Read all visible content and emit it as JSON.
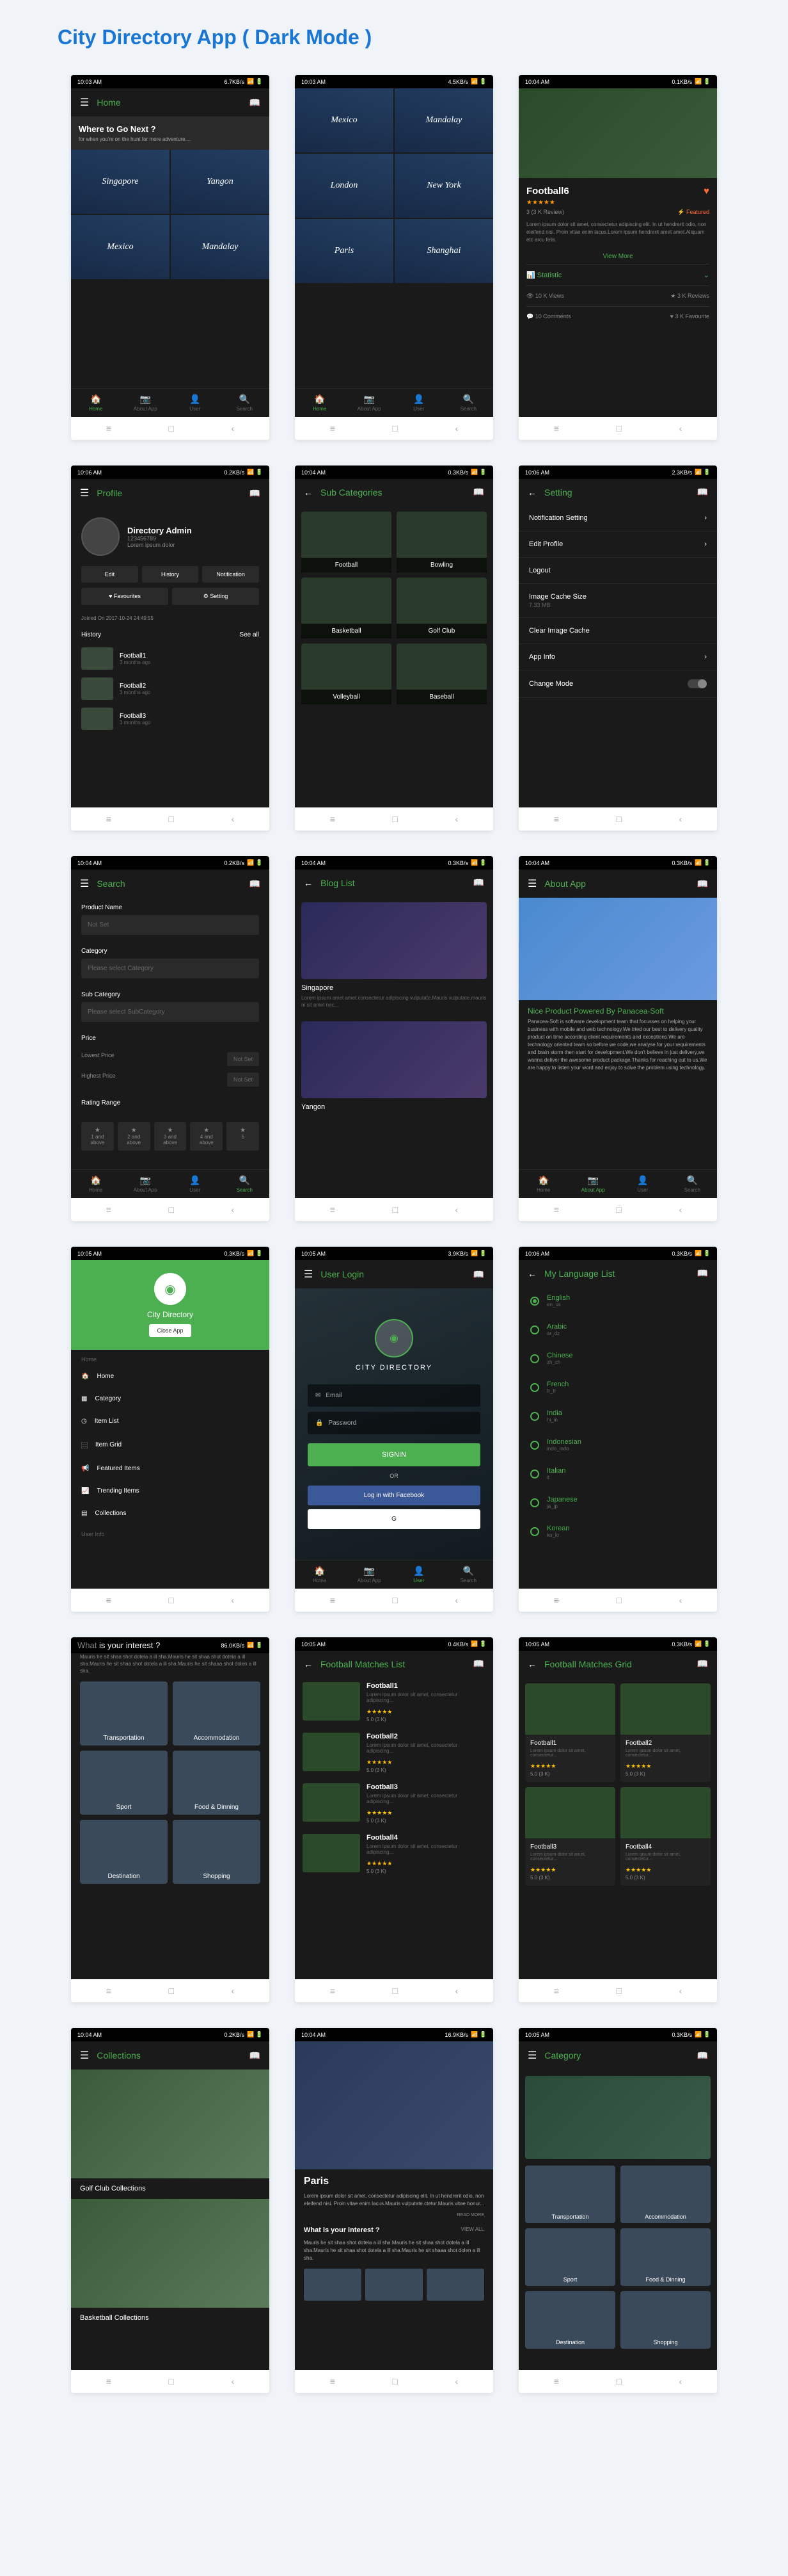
{
  "page_title": "City Directory App ( Dark Mode )",
  "status": {
    "time_a": "10:03 AM",
    "time_b": "10:04 AM",
    "time_c": "10:05 AM",
    "time_d": "10:06 AM",
    "net1": "6.7KB/s",
    "net2": "4.5KB/s",
    "net3": "0.1KB/s",
    "net4": "0.2KB/s",
    "net5": "2.3KB/s",
    "net6": "0.3KB/s",
    "net7": "3.9KB/s",
    "net8": "0.4KB/s",
    "net9": "86.0KB/s",
    "net10": "16.9KB/s",
    "sig": "📶 🔋"
  },
  "tabs": {
    "home": "Home",
    "about": "About App",
    "user": "User",
    "search": "Search"
  },
  "home": {
    "title": "Home",
    "banner_title": "Where to Go Next ?",
    "banner_sub": "for when you're on the hunt for more adventure....",
    "cities": [
      "Singapore",
      "Yangon",
      "Mexico",
      "Mandalay"
    ]
  },
  "cities2": [
    "Mexico",
    "Mandalay",
    "London",
    "New York",
    "Paris",
    "Shanghai"
  ],
  "detail": {
    "title": "Football6",
    "stars": "★★★★★",
    "reviews": "3 (3 K Review)",
    "featured": "⚡ Featured",
    "desc": "Lorem ipsum dolor sit amet, consectetur adipiscing elit. In ut hendrerit odio, non eleifend nisi. Proin vitae enim lacus.Lorem ipsum hendrerit amet amet.Aliquam etc arcu felis.",
    "view_more": "View More",
    "stat": "Statistic",
    "views": "👁 10 K Views",
    "reviews_s": "★ 3 K Reviews",
    "comments": "💬 10 Comments",
    "favs": "♥ 3 K Favourite"
  },
  "profile": {
    "title": "Profile",
    "name": "Directory Admin",
    "id": "123456789",
    "sub": "Lorem ipsum dolor",
    "edit": "Edit",
    "history": "History",
    "notif": "Notification",
    "favs": "♥ Favourites",
    "setting": "⚙ Setting",
    "joined": "Joined On 2017-10-24 24:49:55",
    "hist_label": "History",
    "seeall": "See all",
    "items": [
      {
        "t": "Football1",
        "s": "3 months ago"
      },
      {
        "t": "Football2",
        "s": "3 months ago"
      },
      {
        "t": "Football3",
        "s": "3 months ago"
      }
    ]
  },
  "subcat": {
    "title": "Sub Categories",
    "items": [
      "Football",
      "Bowling",
      "Basketball",
      "Golf Club",
      "Volleyball",
      "Baseball"
    ]
  },
  "setting": {
    "title": "Setting",
    "notif": "Notification Setting",
    "edit": "Edit Profile",
    "logout": "Logout",
    "cache": "Image Cache Size",
    "cache_val": "7.33 MB",
    "clear": "Clear Image Cache",
    "info": "App Info",
    "mode": "Change Mode"
  },
  "search": {
    "title": "Search",
    "pname": "Product Name",
    "notset": "Not Set",
    "cat": "Category",
    "pcat": "Please select Category",
    "subcat": "Sub Category",
    "psubcat": "Please select SubCategory",
    "price": "Price",
    "lowp": "Lowest Price",
    "highp": "Highest Price",
    "rating": "Rating Range",
    "r1": "1 and",
    "r2": "2 and",
    "r3": "3 and",
    "r4": "4 and",
    "r5": "5",
    "above": "above"
  },
  "blog": {
    "title": "Blog List",
    "items": [
      {
        "t": "Singapore",
        "d": "Lorem ipsum amet amet.consectetur adipiscing vulputate.Mauris vulputate.mauris ni sit amet nec..."
      },
      {
        "t": "Yangon"
      }
    ]
  },
  "about": {
    "title": "About App",
    "heading": "Nice Product Powered By Panacea-Soft",
    "desc": "Panacea-Soft is software development team that focusses on helping your business with mobile and web technology.We tried our best to delivery quality product on time according client requirements and exceptions.We are technology oriented team so before we code,we analyse for your requirements and brain storm then start for development.We don't believe in just delivery,we wanna deliver the awesome product package.Thanks for reaching out to us.We are happy to listen your word and enjoy to solve the problem using technology."
  },
  "drawer": {
    "brand": "City Directory",
    "close": "Close App",
    "sec1": "Home",
    "home": "Home",
    "cat": "Category",
    "list": "Item List",
    "grid": "Item Grid",
    "feat": "Featured Items",
    "trend": "Trending Items",
    "coll": "Collections",
    "sec2": "User Info"
  },
  "login": {
    "title": "User Login",
    "brand": "CITY DIRECTORY",
    "email": "Email",
    "pass": "Password",
    "signin": "SIGNIN",
    "or": "OR",
    "fb": "Log in with Facebook",
    "g": "G"
  },
  "lang": {
    "title": "My Language List",
    "items": [
      {
        "n": "English",
        "c": "en_us",
        "checked": true
      },
      {
        "n": "Arabic",
        "c": "ar_dz"
      },
      {
        "n": "Chinese",
        "c": "zh_ch"
      },
      {
        "n": "French",
        "c": "fr_fr"
      },
      {
        "n": "India",
        "c": "hi_in"
      },
      {
        "n": "Indonesian",
        "c": "indo_indo"
      },
      {
        "n": "Italian",
        "c": "it"
      },
      {
        "n": "Japanese",
        "c": "ja_jp"
      },
      {
        "n": "Korean",
        "c": "ko_kr"
      }
    ]
  },
  "interest": {
    "what": "What ",
    "title": "is your interest ?",
    "desc": "Mauris he sit shaa shot dotela a ill sha.Mauris he sit shaa shot dotela a ill sha.Mauris he sit shaa shot dotela a ill sha.Mauris he sit shaaa shot dolen a ill sha.",
    "items": [
      "Transportation",
      "Accommodation",
      "Sport",
      "Food & Dinning",
      "Destination",
      "Shopping"
    ]
  },
  "matches_list": {
    "title": "Football Matches List",
    "items": [
      {
        "t": "Football1",
        "d": "Lorem ipsum dolor sit amet, consectetur adipiscing...",
        "s": "★★★★★",
        "r": "5.0 (3 K)"
      },
      {
        "t": "Football2",
        "d": "Lorem ipsum dolor sit amet, consectetur adipiscing...",
        "s": "★★★★★",
        "r": "5.0 (3 K)"
      },
      {
        "t": "Football3",
        "d": "Lorem ipsum dolor sit amet, consectetur adipiscing...",
        "s": "★★★★★",
        "r": "5.0 (3 K)"
      },
      {
        "t": "Football4",
        "d": "Lorem ipsum dolor sit amet, consectetur adipiscing...",
        "s": "★★★★★",
        "r": "5.0 (3 K)"
      }
    ]
  },
  "matches_grid": {
    "title": "Football Matches Grid",
    "items": [
      {
        "t": "Football1",
        "d": "Lorem ipsum dolor sit amet, consectetur...",
        "s": "★★★★★",
        "r": "5.0 (3 K)"
      },
      {
        "t": "Football2",
        "d": "Lorem ipsum dolor sit amet, consectetur...",
        "s": "★★★★★",
        "r": "5.0 (3 K)"
      },
      {
        "t": "Football3",
        "d": "Lorem ipsum dolor sit amet, consectetur...",
        "s": "★★★★★",
        "r": "5.0 (3 K)"
      },
      {
        "t": "Football4",
        "d": "Lorem ipsum dolor sit amet, consectetur...",
        "s": "★★★★★",
        "r": "5.0 (3 K)"
      }
    ]
  },
  "collections": {
    "title": "Collections",
    "items": [
      "Golf Club Collections",
      "Basketball Collections"
    ]
  },
  "paris": {
    "title": "Paris",
    "desc": "Lorem ipsum dolor sit amet, consectetur adipiscing elit. In ut hendrerit odio, non eleifend nisi. Proin vitae enim lacus.Mauris vulputate.ctetur.Mauris vitae bonur...",
    "readmore": "READ MORE",
    "interest": "What is your interest ?",
    "viewall": "VIEW ALL",
    "idesc": "Mauris he sit shaa shot dotela a ill sha.Mauris he sit shaa shot dotela a ill sha.Mauris he sit shaa shot dotela a ill sha.Mauris he sit shaaa shot dolen a ill sha."
  },
  "category": {
    "title": "Category",
    "items": [
      "Transportation",
      "Accommodation",
      "Sport",
      "Food & Dinning",
      "Destination",
      "Shopping"
    ]
  }
}
